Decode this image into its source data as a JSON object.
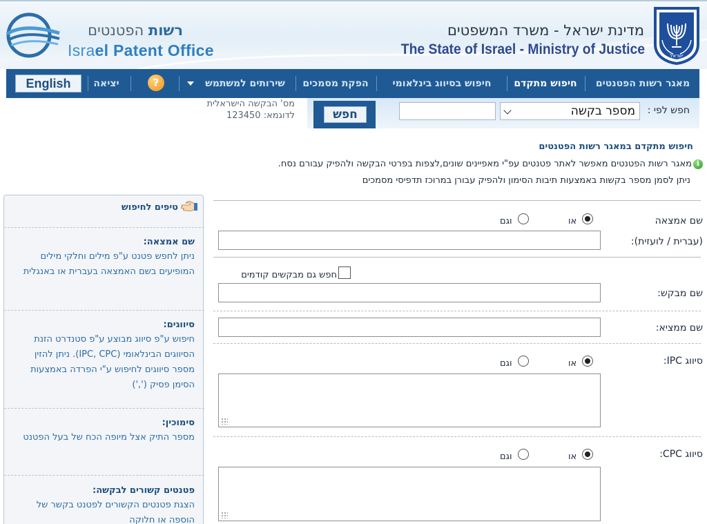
{
  "header": {
    "office_name_he_first": "רשות",
    "office_name_he_rest": "הפטנטים",
    "office_name_en_pre": "Isra",
    "office_name_en_rest": "el Patent Office",
    "ministry_he": "מדינת ישראל - משרד המשפטים",
    "ministry_en": "The State of Israel - Ministry of Justice",
    "emblem_label": "ישראל"
  },
  "nav": {
    "items": [
      {
        "label": "מאגר רשות הפטנטים",
        "active": false
      },
      {
        "label": "חיפוש מתקדם",
        "active": true
      },
      {
        "label": "חיפוש בסיווג בינלאומי",
        "active": false
      },
      {
        "label": "הפקת מסמכים",
        "active": false
      },
      {
        "label": "שירותים למשתמש",
        "active": false
      },
      {
        "label": "יציאה",
        "active": false
      }
    ],
    "help_label": "?",
    "english_label": "English"
  },
  "quick_search": {
    "search_by_label": "חפש לפי :",
    "selected_option": "מספר בקשה",
    "input_value": "",
    "search_button": "חפש",
    "hint_line1": "מס' הבקשה הישראלית",
    "hint_line2": "לדוגמא: 123450"
  },
  "page": {
    "title": "חיפוש מתקדם במאגר רשות הפטנטים",
    "info_line1": "מאגר רשות הפטנטים מאפשר לאתר פטנטים עפ\"י מאפיינים שונים,לצפות בפרטי הבקשה ולהפיק עבורם נסח.",
    "info_line2": "ניתן לסמן מספר בקשות באמצעות תיבות הסימון ולהפיק עבורן במרוכז תדפיסי מסמכים"
  },
  "form": {
    "invention_name_label": "שם אמצאה",
    "invention_name_sub": "(עברית / לועזית):",
    "or_label": "או",
    "and_label": "וגם",
    "invention_or_selected": true,
    "applicant_label": "שם מבקש:",
    "search_previous_label": "חפש גם מבקשים קודמים",
    "search_previous_checked": false,
    "inventor_label": "שם ממציא:",
    "ipc_label": "סיווג IPC:",
    "ipc_or_selected": true,
    "cpc_label": "סיווג CPC:",
    "cpc_or_selected": true
  },
  "tips": {
    "title": "טיפים לחיפוש",
    "sections": [
      {
        "heading": "שם אמצאה:",
        "body": "ניתן לחפש פטנט ע\"פ מילים וחלקי מילים המופיעים בשם האמצאה בעברית או באנגלית"
      },
      {
        "heading": "סיווגים:",
        "body": "חיפוש ע\"פ סיווג מבוצע ע\"פ סטנדרט הזנת הסיווגים הבינלאומי (IPC, CPC). ניתן להזין מספר סיווגים לחיפוש ע\"י הפרדה באמצעות הסימן פסיק (',')"
      },
      {
        "heading": "סימוכין:",
        "body": "מספר התיק אצל מיופה הכח של בעל הפטנט"
      },
      {
        "heading": "פטנטים קשורים לבקשה:",
        "body": "הצגת פטנטים הקשורים לפטנט בקשר של הוספה או חלוקה"
      }
    ]
  },
  "colors": {
    "nav_bg": "#1f5a94",
    "title_blue": "#1f4f7e",
    "tip_text": "#2d6ca6"
  }
}
